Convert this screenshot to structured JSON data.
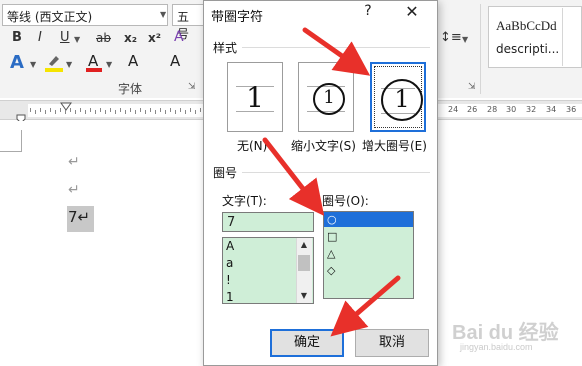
{
  "ribbon": {
    "font_name": "等线 (西文正文)",
    "font_size": "五号",
    "bold": "B",
    "italic": "I",
    "underline": "U",
    "strikethrough": "ab",
    "subscript": "x₂",
    "superscript": "x²",
    "text_effects": "A",
    "font_color_letter": "A",
    "grow_font": "A",
    "clear_format": "A",
    "group_label": "字体",
    "style_sample": "AaBbCcDd",
    "style_name": "descripti..."
  },
  "ruler": {
    "numbers": [
      "24",
      "26",
      "28",
      "30",
      "32",
      "34",
      "36"
    ]
  },
  "document": {
    "para_mark": "↵",
    "line3_text": "7↵"
  },
  "dialog": {
    "title": "带圈字符",
    "help": "?",
    "close": "✕",
    "style_section": "样式",
    "styles": [
      {
        "glyph": "1",
        "label": "无(N)"
      },
      {
        "glyph": "1",
        "label": "缩小文字(S)"
      },
      {
        "glyph": "1",
        "label": "增大圈号(E)"
      }
    ],
    "enclosure_section": "圈号",
    "text_label": "文字(T):",
    "text_value": "7",
    "text_list": [
      "A",
      "a",
      "!",
      "1"
    ],
    "enclosure_label": "圈号(O):",
    "enclosures": [
      "○",
      "□",
      "△",
      "◇"
    ],
    "ok": "确定",
    "cancel": "取消"
  },
  "watermark": {
    "text": "Bai du 经验",
    "url": "jingyan.baidu.com"
  },
  "colors": {
    "accent": "#1e6fd9",
    "list_bg": "#cfeed7",
    "arrow": "#e8302a"
  }
}
